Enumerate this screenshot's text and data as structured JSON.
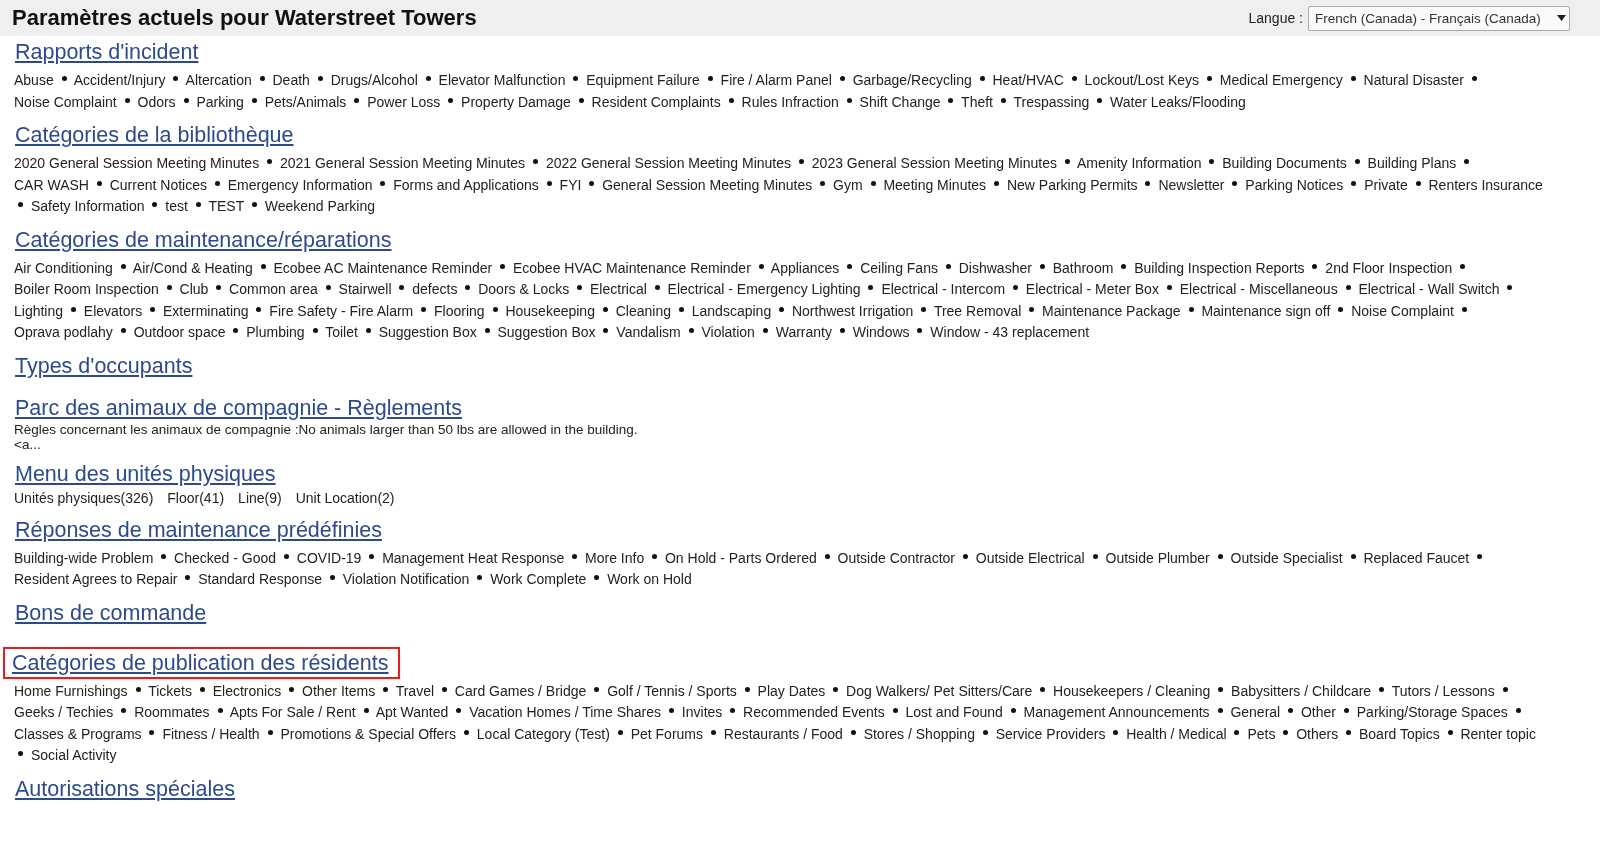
{
  "header": {
    "title": "Paramètres actuels pour Waterstreet Towers",
    "language_label": "Langue :",
    "language_value": "French (Canada) - Français (Canada)"
  },
  "sections": [
    {
      "title": "Rapports d'incident",
      "highlighted": false,
      "kind": "bullets",
      "items": [
        "Abuse",
        "Accident/Injury",
        "Altercation",
        "Death",
        "Drugs/Alcohol",
        "Elevator Malfunction",
        "Equipment Failure",
        "Fire / Alarm Panel",
        "Garbage/Recycling",
        "Heat/HVAC",
        "Lockout/Lost Keys",
        "Medical Emergency",
        "Natural Disaster",
        "Noise Complaint",
        "Odors",
        "Parking",
        "Pets/Animals",
        "Power Loss",
        "Property Damage",
        "Resident Complaints",
        "Rules Infraction",
        "Shift Change",
        "Theft",
        "Trespassing",
        "Water Leaks/Flooding"
      ]
    },
    {
      "title": "Catégories de la bibliothèque",
      "highlighted": false,
      "kind": "bullets",
      "items": [
        "2020 General Session Meeting Minutes",
        "2021 General Session Meeting Minutes",
        "2022 General Session Meeting Minutes",
        "2023 General Session Meeting Minutes",
        "Amenity Information",
        "Building Documents",
        "Building Plans",
        "CAR WASH",
        "Current Notices",
        "Emergency Information",
        "Forms and Applications",
        "FYI",
        "General Session Meeting Minutes",
        "Gym",
        "Meeting Minutes",
        "New Parking Permits",
        "Newsletter",
        "Parking Notices",
        "Private",
        "Renters Insurance",
        "Safety Information",
        "test",
        "TEST",
        "Weekend Parking"
      ]
    },
    {
      "title": "Catégories de maintenance/réparations",
      "highlighted": false,
      "kind": "bullets",
      "items": [
        "Air Conditioning",
        "Air/Cond & Heating",
        "Ecobee AC Maintenance Reminder",
        "Ecobee HVAC Maintenance Reminder",
        "Appliances",
        "Ceiling Fans",
        "Dishwasher",
        "Bathroom",
        "Building Inspection Reports",
        "2nd Floor Inspection",
        "Boiler Room Inspection",
        "Club",
        "Common area",
        "Stairwell",
        "defects",
        "Doors & Locks",
        "Electrical",
        "Electrical - Emergency Lighting",
        "Electrical - Intercom",
        "Electrical - Meter Box",
        "Electrical - Miscellaneous",
        "Electrical - Wall Switch",
        "Lighting",
        "Elevators",
        "Exterminating",
        "Fire Safety - Fire Alarm",
        "Flooring",
        "Housekeeping",
        "Cleaning",
        "Landscaping",
        "Northwest Irrigation",
        "Tree Removal",
        "Maintenance Package",
        "Maintenance sign off",
        "Noise Complaint",
        "Oprava podlahy",
        "Outdoor space",
        "Plumbing",
        "Toilet",
        "Suggestion Box",
        "Suggestion Box",
        "Vandalism",
        "Violation",
        "Warranty",
        "Windows",
        "Window - 43 replacement"
      ]
    },
    {
      "title": "Types d'occupants",
      "highlighted": false,
      "kind": "empty"
    },
    {
      "title": "Parc des animaux de compagnie - Règlements",
      "highlighted": false,
      "kind": "text",
      "lines": [
        "Règles concernant les animaux de compagnie :No animals larger than 50 lbs are allowed in the building.",
        "<a..."
      ]
    },
    {
      "title": "Menu des unités physiques",
      "highlighted": false,
      "kind": "counts",
      "items": [
        "Unités physiques(326)",
        "Floor(41)",
        "Line(9)",
        "Unit Location(2)"
      ]
    },
    {
      "title": "Réponses de maintenance prédéfinies",
      "highlighted": false,
      "kind": "bullets",
      "items": [
        "Building-wide Problem",
        "Checked - Good",
        "COVID-19",
        "Management Heat Response",
        "More Info",
        "On Hold - Parts Ordered",
        "Outside Contractor",
        "Outside Electrical",
        "Outside Plumber",
        "Outside Specialist",
        "Replaced Faucet",
        "Resident Agrees to Repair",
        "Standard Response",
        "Violation Notification",
        "Work Complete",
        "Work on Hold"
      ]
    },
    {
      "title": "Bons de commande",
      "highlighted": false,
      "kind": "empty"
    },
    {
      "title": "Catégories de publication des résidents",
      "highlighted": true,
      "kind": "bullets",
      "items": [
        "Home Furnishings",
        "Tickets",
        "Electronics",
        "Other Items",
        "Travel",
        "Card Games / Bridge",
        "Golf / Tennis / Sports",
        "Play Dates",
        "Dog Walkers/ Pet Sitters/Care",
        "Housekeepers / Cleaning",
        "Babysitters / Childcare",
        "Tutors / Lessons",
        "Geeks / Techies",
        "Roommates",
        "Apts For Sale / Rent",
        "Apt Wanted",
        "Vacation Homes / Time Shares",
        "Invites",
        "Recommended Events",
        "Lost and Found",
        "Management Announcements",
        "General",
        "Other",
        "Parking/Storage Spaces",
        "Classes & Programs",
        "Fitness / Health",
        "Promotions & Special Offers",
        "Local Category (Test)",
        "Pet Forums",
        "Restaurants / Food",
        "Stores / Shopping",
        "Service Providers",
        "Health / Medical",
        "Pets",
        "Others",
        "Board Topics",
        "Renter topic",
        "Social Activity"
      ]
    },
    {
      "title": "Autorisations spéciales",
      "highlighted": false,
      "kind": "empty"
    }
  ]
}
